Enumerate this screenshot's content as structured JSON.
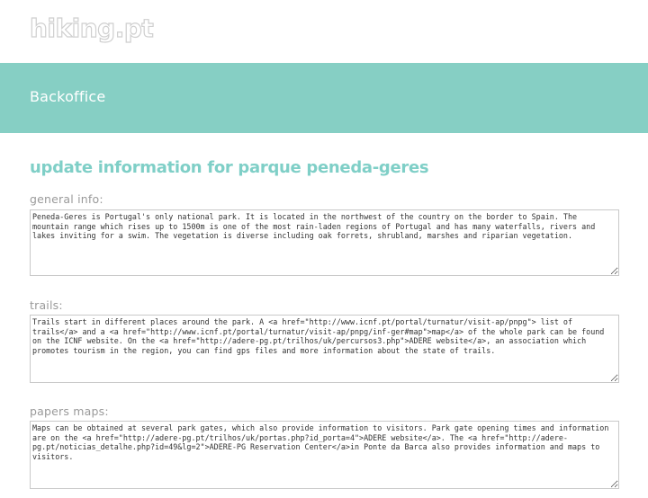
{
  "site": {
    "logo_text": "hiking.pt"
  },
  "banner": {
    "title": "Backoffice",
    "background_color": "#86cfc4"
  },
  "page": {
    "heading": "update information for parque peneda-geres",
    "heading_color": "#7fcfc7"
  },
  "form": {
    "general_info": {
      "label": "general info:",
      "value": "Peneda-Geres is Portugal's only national park. It is located in the northwest of the country on the border to Spain. The mountain range which rises up to 1500m is one of the most rain-laden regions of Portugal and has many waterfalls, rivers and lakes inviting for a swim. The vegetation is diverse including oak forrets, shrubland, marshes and riparian vegetation."
    },
    "trails": {
      "label": "trails:",
      "value": "Trails start in different places around the park. A <a href=\"http://www.icnf.pt/portal/turnatur/visit-ap/pnpg\"> list of trails</a> and a <a href=\"http://www.icnf.pt/portal/turnatur/visit-ap/pnpg/inf-ger#map\">map</a> of the whole park can be found on the ICNF website. On the <a href=\"http://adere-pg.pt/trilhos/uk/percursos3.php\">ADERE website</a>, an association which promotes tourism in the region, you can find gps files and more information about the state of trails."
    },
    "papers_maps": {
      "label": "papers maps:",
      "value": "Maps can be obtained at several park gates, which also provide information to visitors. Park gate opening times and information are on the <a href=\"http://adere-pg.pt/trilhos/uk/portas.php?id_porta=4\">ADERE website</a>. The <a href=\"http://adere-pg.pt/noticias_detalhe.php?id=49&lg=2\">ADERE-PG Reservation Center</a>in Ponte da Barca also provides information and maps to visitors."
    }
  }
}
